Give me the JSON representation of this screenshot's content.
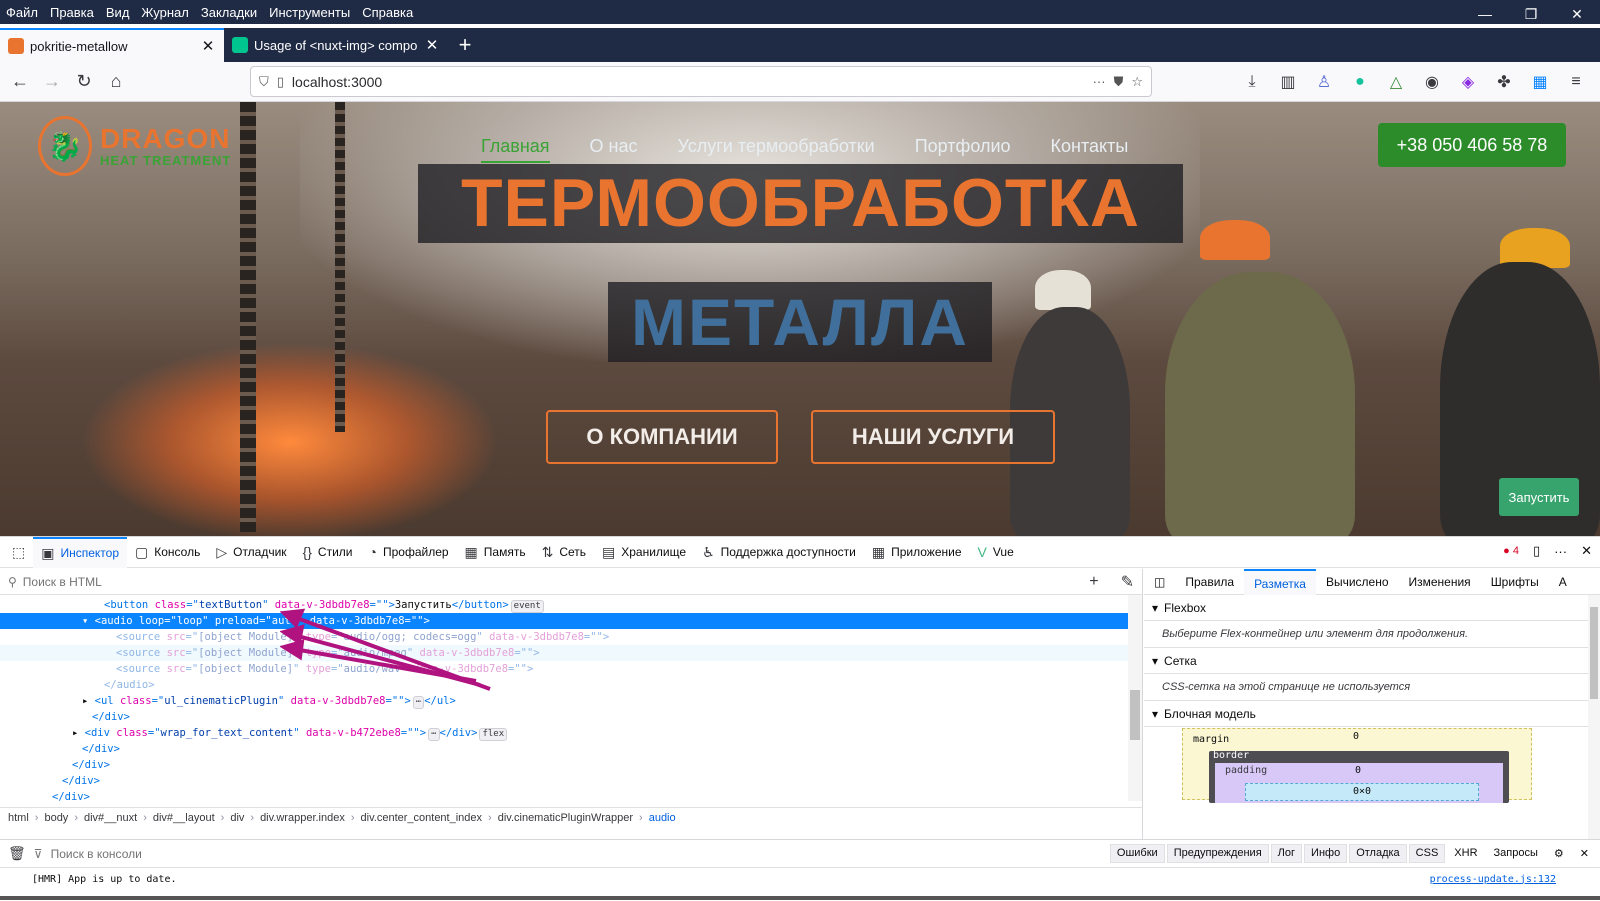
{
  "menu": [
    "Файл",
    "Правка",
    "Вид",
    "Журнал",
    "Закладки",
    "Инструменты",
    "Справка"
  ],
  "window_controls": {
    "minimize": "—",
    "restore": "❐",
    "close": "✕"
  },
  "tabs": [
    {
      "title": "pokritie-metallow",
      "active": true,
      "favicon_color": "#e8742f"
    },
    {
      "title": "Usage of <nuxt-img> compon",
      "active": false,
      "favicon_color": "#00c58e"
    }
  ],
  "new_tab": "+",
  "urlbar": {
    "url": "localhost:3000",
    "more": "···"
  },
  "site": {
    "logo_line1": "DRAGON",
    "logo_line2": "HEAT TREATMENT",
    "nav": [
      "Главная",
      "О нас",
      "Услуги термообработки",
      "Портфолио",
      "Контакты"
    ],
    "phone": "+38 050 406 58 78",
    "headline1": "ТЕРМООБРАБОТКА",
    "headline2": "МЕТАЛЛА",
    "cta1": "О КОМПАНИИ",
    "cta2": "НАШИ УСЛУГИ",
    "run_button": "Запустить",
    "colors": {
      "orange": "#e8742f",
      "green": "#3aa335",
      "blue": "#3f6f9a"
    }
  },
  "devtools": {
    "tabs": [
      "Инспектор",
      "Консоль",
      "Отладчик",
      "Стили",
      "Профайлер",
      "Память",
      "Сеть",
      "Хранилище",
      "Поддержка доступности",
      "Приложение",
      "Vue"
    ],
    "tab_icons": [
      "pick-icon",
      "console-icon",
      "debugger-icon",
      "styles-icon",
      "profiler-icon",
      "memory-icon",
      "network-icon",
      "storage-icon",
      "accessibility-icon",
      "application-icon",
      "vue-icon"
    ],
    "error_count": "4",
    "search_placeholder": "Поиск в HTML",
    "tree": [
      {
        "indent": 104,
        "html": [
          [
            "tg",
            "<button "
          ],
          [
            "at",
            "class"
          ],
          [
            "tg",
            "=\""
          ],
          [
            "av",
            "textButton"
          ],
          [
            "tg",
            "\" "
          ],
          [
            "at",
            "data-v-3dbdb7e8"
          ],
          [
            "tg",
            "=\"\">"
          ],
          [
            "",
            "Запустить"
          ],
          [
            "tg",
            "</button>"
          ]
        ],
        "badge": "event"
      },
      {
        "indent": 92,
        "sel": true,
        "twisty": "▾",
        "html": [
          [
            "tg",
            "<audio "
          ],
          [
            "at",
            "loop"
          ],
          [
            "tg",
            "=\""
          ],
          [
            "av",
            "loop"
          ],
          [
            "tg",
            "\" "
          ],
          [
            "at",
            "preload"
          ],
          [
            "tg",
            "=\""
          ],
          [
            "av",
            "auto"
          ],
          [
            "tg",
            "\" "
          ],
          [
            "at",
            "data-v-3dbdb7e8"
          ],
          [
            "tg",
            "=\"\">"
          ]
        ]
      },
      {
        "indent": 116,
        "dim": true,
        "html": [
          [
            "tg",
            "<source "
          ],
          [
            "at",
            "src"
          ],
          [
            "tg",
            "=\""
          ],
          [
            "av",
            "[object Module]"
          ],
          [
            "tg",
            "\" "
          ],
          [
            "at",
            "type"
          ],
          [
            "tg",
            "=\""
          ],
          [
            "av",
            "audio/ogg; codecs=ogg"
          ],
          [
            "tg",
            "\" "
          ],
          [
            "at",
            "data-v-3dbdb7e8"
          ],
          [
            "tg",
            "=\"\">"
          ]
        ]
      },
      {
        "indent": 116,
        "dim": true,
        "hov": true,
        "html": [
          [
            "tg",
            "<source "
          ],
          [
            "at",
            "src"
          ],
          [
            "tg",
            "=\""
          ],
          [
            "av",
            "[object Module]"
          ],
          [
            "tg",
            "\" "
          ],
          [
            "at",
            "type"
          ],
          [
            "tg",
            "=\""
          ],
          [
            "av",
            "audio/mpeg"
          ],
          [
            "tg",
            "\" "
          ],
          [
            "at",
            "data-v-3dbdb7e8"
          ],
          [
            "tg",
            "=\"\">"
          ]
        ]
      },
      {
        "indent": 116,
        "dim": true,
        "html": [
          [
            "tg",
            "<source "
          ],
          [
            "at",
            "src"
          ],
          [
            "tg",
            "=\""
          ],
          [
            "av",
            "[object Module]"
          ],
          [
            "tg",
            "\" "
          ],
          [
            "at",
            "type"
          ],
          [
            "tg",
            "=\""
          ],
          [
            "av",
            "audio/wav"
          ],
          [
            "tg",
            "\" "
          ],
          [
            "at",
            "data-v-3dbdb7e8"
          ],
          [
            "tg",
            "=\"\">"
          ]
        ]
      },
      {
        "indent": 104,
        "dim": true,
        "html": [
          [
            "tg",
            "</audio>"
          ]
        ]
      },
      {
        "indent": 92,
        "twisty": "▸",
        "html": [
          [
            "tg",
            "<ul "
          ],
          [
            "at",
            "class"
          ],
          [
            "tg",
            "=\""
          ],
          [
            "av",
            "ul_cinematicPlugin"
          ],
          [
            "tg",
            "\" "
          ],
          [
            "at",
            "data-v-3dbdb7e8"
          ],
          [
            "tg",
            "=\"\">"
          ],
          [
            "badge",
            "⋯"
          ],
          [
            "tg",
            "</ul>"
          ]
        ]
      },
      {
        "indent": 92,
        "html": [
          [
            "tg",
            "</div>"
          ]
        ]
      },
      {
        "indent": 82,
        "twisty": "▸",
        "html": [
          [
            "tg",
            "<div "
          ],
          [
            "at",
            "class"
          ],
          [
            "tg",
            "=\""
          ],
          [
            "av",
            "wrap_for_text_content"
          ],
          [
            "tg",
            "\" "
          ],
          [
            "at",
            "data-v-b472ebe8"
          ],
          [
            "tg",
            "=\"\">"
          ],
          [
            "badge",
            "⋯"
          ],
          [
            "tg",
            "</div>"
          ]
        ],
        "badge": "flex"
      },
      {
        "indent": 82,
        "html": [
          [
            "tg",
            "</div>"
          ]
        ]
      },
      {
        "indent": 72,
        "html": [
          [
            "tg",
            "</div>"
          ]
        ]
      },
      {
        "indent": 62,
        "html": [
          [
            "tg",
            "</div>"
          ]
        ]
      },
      {
        "indent": 52,
        "html": [
          [
            "tg",
            "</div>"
          ]
        ]
      }
    ],
    "breadcrumbs": [
      "html",
      "body",
      "div#__nuxt",
      "div#__layout",
      "div",
      "div.wrapper.index",
      "div.center_content_index",
      "div.cinematicPluginWrapper",
      "audio"
    ],
    "side_tabs": [
      "Правила",
      "Разметка",
      "Вычислено",
      "Изменения",
      "Шрифты",
      "А"
    ],
    "side_active": "Разметка",
    "flexbox_title": "Flexbox",
    "flexbox_note": "Выберите Flex-контейнер или элемент для продолжения.",
    "grid_title": "Сетка",
    "grid_note": "CSS-сетка на этой странице не используется",
    "boxmodel_title": "Блочная модель",
    "boxmodel": {
      "margin": "margin",
      "border": "border",
      "padding": "padding",
      "content": "0×0",
      "zero": "0"
    },
    "console_placeholder": "Поиск в консоли",
    "console_filters": [
      "Ошибки",
      "Предупреждения",
      "Лог",
      "Инфо",
      "Отладка",
      "CSS",
      "XHR",
      "Запросы"
    ],
    "console_message": "[HMR] App is up to date.",
    "console_source": "process-update.js:132"
  }
}
